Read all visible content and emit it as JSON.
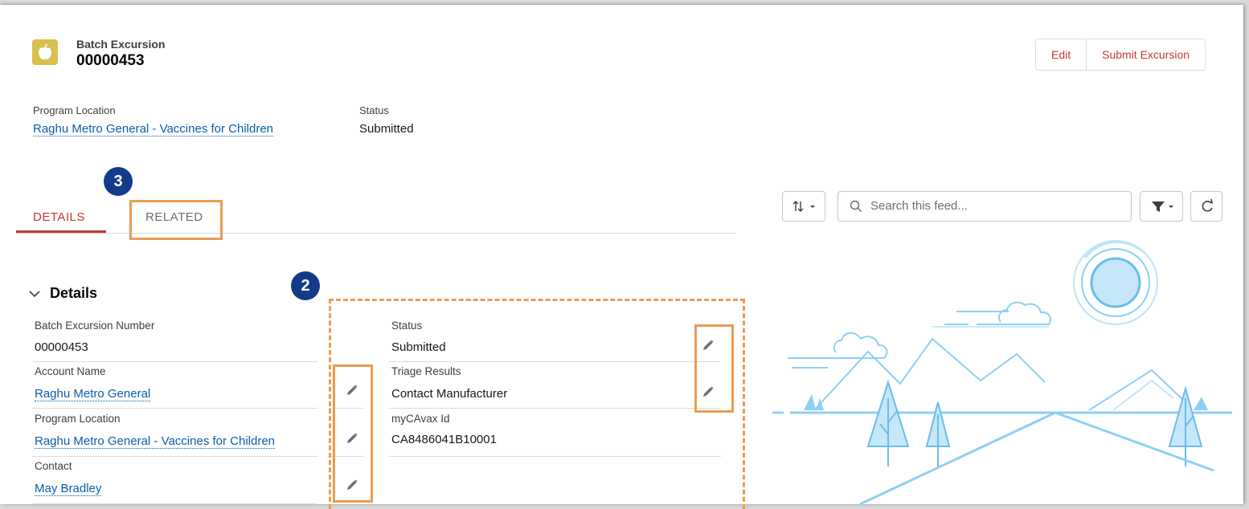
{
  "header": {
    "object_type": "Batch Excursion",
    "record_name": "00000453",
    "buttons": {
      "edit": "Edit",
      "submit": "Submit Excursion"
    }
  },
  "highlights": {
    "program_location_label": "Program Location",
    "program_location_value": "Raghu Metro General - Vaccines for Children",
    "status_label": "Status",
    "status_value": "Submitted"
  },
  "tabs": {
    "details": "DETAILS",
    "related": "RELATED"
  },
  "callouts": {
    "related": "3",
    "fields": "2"
  },
  "section": {
    "title": "Details",
    "left_fields": [
      {
        "label": "Batch Excursion Number",
        "value": "00000453"
      },
      {
        "label": "Account Name",
        "value": "Raghu Metro General"
      },
      {
        "label": "Program Location",
        "value": "Raghu Metro General - Vaccines for Children"
      },
      {
        "label": "Contact",
        "value": "May Bradley"
      }
    ],
    "right_fields": [
      {
        "label": "Status",
        "value": "Submitted"
      },
      {
        "label": "Triage Results",
        "value": "Contact Manufacturer"
      },
      {
        "label": "myCAvax Id",
        "value": "CA8486041B10001"
      }
    ]
  },
  "feed": {
    "search_placeholder": "Search this feed..."
  },
  "colors": {
    "accent": "#c23934",
    "link": "#0b5cab",
    "highlight": "#ec9b52",
    "callout": "#143a8a",
    "icon": "#d7c04e"
  }
}
